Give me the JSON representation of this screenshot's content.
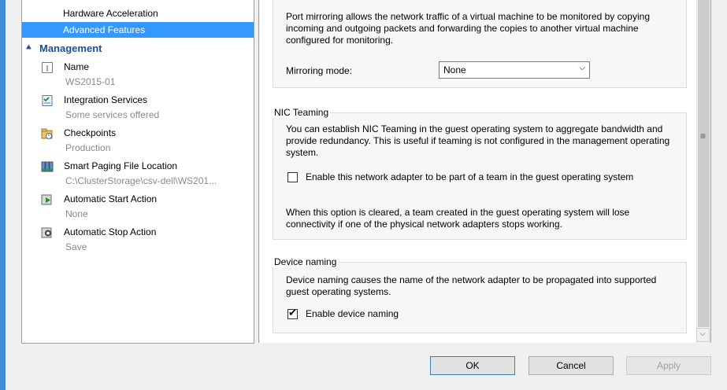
{
  "nav": {
    "hardware_acceleration": "Hardware Acceleration",
    "advanced_features": "Advanced Features"
  },
  "management": {
    "header": "Management",
    "items": [
      {
        "label": "Name",
        "sub": "WS2015-01",
        "icon": "name-icon"
      },
      {
        "label": "Integration Services",
        "sub": "Some services offered",
        "icon": "integration-services-icon"
      },
      {
        "label": "Checkpoints",
        "sub": "Production",
        "icon": "checkpoints-icon"
      },
      {
        "label": "Smart Paging File Location",
        "sub": "C:\\ClusterStorage\\csv-dell\\WS201...",
        "icon": "smart-paging-icon"
      },
      {
        "label": "Automatic Start Action",
        "sub": "None",
        "icon": "auto-start-icon"
      },
      {
        "label": "Automatic Stop Action",
        "sub": "Save",
        "icon": "auto-stop-icon"
      }
    ]
  },
  "port_mirroring": {
    "description": "Port mirroring allows the network traffic of a virtual machine to be monitored by copying incoming and outgoing packets and forwarding the copies to another virtual machine configured for monitoring.",
    "mode_label": "Mirroring mode:",
    "mode_value": "None"
  },
  "nic_teaming": {
    "title": "NIC Teaming",
    "description": "You can establish NIC Teaming in the guest operating system to aggregate bandwidth and provide redundancy. This is useful if teaming is not configured in the management operating system.",
    "checkbox_label": "Enable this network adapter to be part of a team in the guest operating system",
    "checked": false,
    "note": "When this option is cleared, a team created in the guest operating system will lose connectivity if one of the physical network adapters stops working."
  },
  "device_naming": {
    "title": "Device naming",
    "description": "Device naming causes the name of the network adapter to be propagated into supported guest operating systems.",
    "checkbox_label": "Enable device naming",
    "checked": true
  },
  "buttons": {
    "ok": "OK",
    "cancel": "Cancel",
    "apply": "Apply"
  }
}
